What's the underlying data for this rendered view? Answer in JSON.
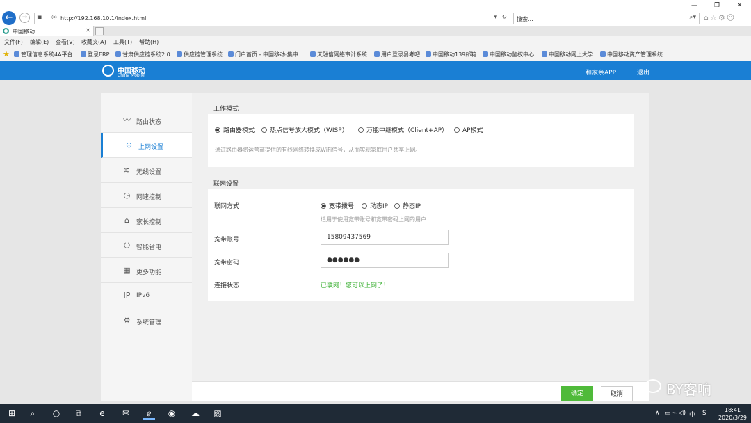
{
  "browser": {
    "url": "http://192.168.10.1/index.html",
    "search_placeholder": "搜索...",
    "tab_title": "中国移动",
    "menu": [
      "文件(F)",
      "编辑(E)",
      "查看(V)",
      "收藏夹(A)",
      "工具(T)",
      "帮助(H)"
    ],
    "favorites": [
      "管理信息系统4A平台",
      "登录ERP",
      "甘肃供应链系统2.0",
      "供应链管理系统",
      "门户首页 - 中国移动-集中...",
      "天融信网络审计系统",
      "用户登录易考吧",
      "中国移动139邮箱",
      "中国移动鉴权中心",
      "中国移动网上大学",
      "中国移动资产管理系统"
    ]
  },
  "header": {
    "logo_cn": "中国移动",
    "logo_en": "China Mobile",
    "app_link": "和家亲APP",
    "logout": "退出"
  },
  "sidebar": {
    "items": [
      {
        "label": "路由状态",
        "icon": "pulse-icon"
      },
      {
        "label": "上网设置",
        "icon": "globe-icon"
      },
      {
        "label": "无线设置",
        "icon": "wifi-icon"
      },
      {
        "label": "网速控制",
        "icon": "speedometer-icon"
      },
      {
        "label": "家长控制",
        "icon": "home-icon"
      },
      {
        "label": "智能省电",
        "icon": "power-icon"
      },
      {
        "label": "更多功能",
        "icon": "grid-icon"
      },
      {
        "label": "IPv6",
        "icon": "ipv6-icon"
      },
      {
        "label": "系统管理",
        "icon": "gear-icon"
      }
    ],
    "active_index": 1
  },
  "work_mode": {
    "title": "工作模式",
    "options": [
      "路由器模式",
      "热点信号放大模式（WISP）",
      "万能中继模式（Client+AP）",
      "AP模式"
    ],
    "selected_index": 0,
    "description": "通过路由器将运营商提供的有线网络转换成WiFi信号，从而实现家庭用户共享上网。"
  },
  "network": {
    "title": "联网设置",
    "method_label": "联网方式",
    "method_options": [
      "宽带拨号",
      "动态IP",
      "静态IP"
    ],
    "method_selected_index": 0,
    "method_hint": "适用于使用宽带账号和宽带密码上网的用户",
    "account_label": "宽带账号",
    "account_value": "15809437569",
    "password_label": "宽带密码",
    "password_value": "●●●●●●",
    "status_label": "连接状态",
    "status_value": "已联网！您可以上网了！"
  },
  "buttons": {
    "ok": "确定",
    "cancel": "取消"
  },
  "watermark": "BY客响",
  "system": {
    "time": "18:41",
    "date": "2020/3/29",
    "ime": "中"
  }
}
